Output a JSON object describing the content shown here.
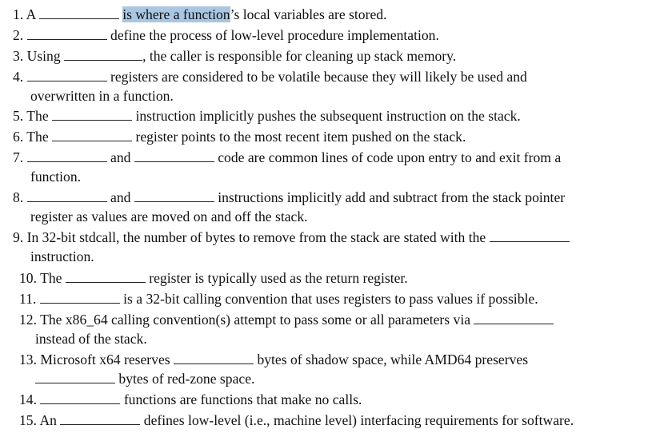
{
  "highlight_color": "#a9c6e2",
  "questions": [
    {
      "num": "1.",
      "lines": [
        {
          "pre": "A",
          "post_highlight": "is where a function",
          "post": "’s local variables are stored."
        }
      ]
    },
    {
      "num": "2.",
      "text": "define the process of low-level procedure implementation."
    },
    {
      "num": "3.",
      "pre": "Using",
      "post": ", the caller is responsible for cleaning up stack memory."
    },
    {
      "num": "4.",
      "text": "registers are considered to be volatile because they will likely be used and",
      "cont": "overwritten in a function."
    },
    {
      "num": "5.",
      "pre": "The",
      "post": "instruction implicitly pushes the subsequent instruction on the stack."
    },
    {
      "num": "6.",
      "pre": "The",
      "post": "register points to the most recent item pushed on the stack."
    },
    {
      "num": "7.",
      "mid": "and",
      "post": "code are common lines of code upon entry to and exit from a",
      "cont": "function."
    },
    {
      "num": "8.",
      "mid": "and",
      "post": "instructions implicitly add and subtract from the stack pointer",
      "cont": "register as values are moved on and off the stack."
    },
    {
      "num": "9.",
      "text": "In 32-bit stdcall, the number of bytes to remove from the stack are stated with the",
      "cont": "instruction."
    },
    {
      "num": "10.",
      "pre": "The",
      "post": "register is typically used as the return register."
    },
    {
      "num": "11.",
      "post": "is a 32-bit calling convention that uses registers to pass values if possible."
    },
    {
      "num": "12.",
      "text": "The x86_64 calling convention(s) attempt to pass some or all parameters via",
      "cont": "instead of the stack."
    },
    {
      "num": "13.",
      "pre": "Microsoft x64 reserves",
      "post": "bytes of shadow space, while AMD64 preserves",
      "cont": "bytes of red-zone space."
    },
    {
      "num": "14.",
      "post": "functions are functions that make no calls."
    },
    {
      "num": "15.",
      "pre": "An",
      "post": "defines low-level (i.e., machine level) interfacing requirements for software."
    }
  ]
}
